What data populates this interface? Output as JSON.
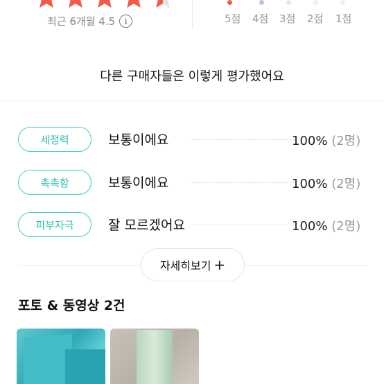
{
  "rating_summary": {
    "stars": {
      "filled": 4.5,
      "max": 5,
      "color": "#f15b4c"
    },
    "recent_label": "최근 6개월 4.5",
    "info_icon": "info-icon",
    "distribution": [
      {
        "label": "5점",
        "dot_color": "#f15b4c"
      },
      {
        "label": "4점",
        "dot_color": "#b9c1de"
      },
      {
        "label": "3점",
        "dot_color": "#e7e7e7"
      },
      {
        "label": "2점",
        "dot_color": "#f0f0f0"
      },
      {
        "label": "1점",
        "dot_color": "#f0f0f0"
      }
    ]
  },
  "evaluation": {
    "title": "다른 구매자들은 이렇게 평가했어요",
    "rows": [
      {
        "tag": "세정력",
        "answer": "보통이에요",
        "percent": "100%",
        "count": "(2명)"
      },
      {
        "tag": "촉촉함",
        "answer": "보통이에요",
        "percent": "100%",
        "count": "(2명)"
      },
      {
        "tag": "피부자극",
        "answer": "잘 모르겠어요",
        "percent": "100%",
        "count": "(2명)"
      }
    ],
    "accent_color": "#3ccfbf",
    "detail_button": {
      "label": "자세히보기",
      "icon": "plus-icon"
    }
  },
  "photos": {
    "title": "포토 & 동영상 2건"
  }
}
